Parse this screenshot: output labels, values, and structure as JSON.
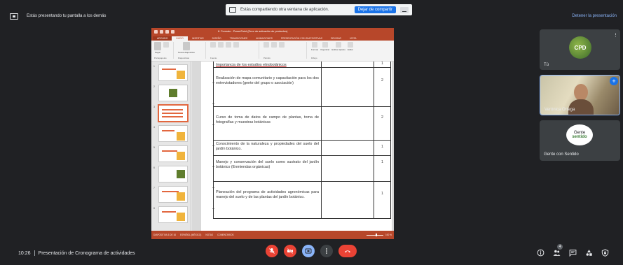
{
  "share_banner": {
    "text": "Estás compartiendo otra ventana de aplicación.",
    "stop_label": "Dejar de compartir"
  },
  "top_bar": {
    "presenting_text": "Estás presentando tu pantalla a los demás",
    "stop_presenting_label": "Detener la presentación"
  },
  "ppt": {
    "window_title": "8. Formato - PowerPoint (Error de activación de productos)",
    "tabs": [
      "ARCHIVO",
      "INICIO",
      "INSERTAR",
      "DISEÑO",
      "TRANSICIONES",
      "ANIMACIONES",
      "PRESENTACIÓN CON DIAPOSITIVAS",
      "REVISAR",
      "VISTA"
    ],
    "ribbon": {
      "paste": "Pegar",
      "new_slide": "Nueva diapositiva",
      "shapes": "Formas",
      "arrange": "Organizar",
      "quick_styles": "Estilos rápidos",
      "edit": "Editar",
      "groups": [
        "Portapapeles",
        "Diapositivas",
        "Fuente",
        "Párrafo",
        "Dibujo"
      ]
    },
    "thumbnail_numbers": [
      "1",
      "2",
      "3",
      "4",
      "5",
      "6",
      "7",
      "8"
    ],
    "table_rows": [
      {
        "activity": "Importancia de los estudios etnobotánicos",
        "value": "1"
      },
      {
        "activity": "Realización de mapa comunitario y capacitación para los dos entrevistadores (gente del grupo o asociación)",
        "value": "2"
      },
      {
        "activity": "Curso de toma de datos de campo de plantas, toma de fotografías y muestras botánicas",
        "value": "2"
      },
      {
        "activity": "Conocimiento de la naturaleza y propiedades del suelo del jardín botánico.",
        "value": "1"
      },
      {
        "activity": "Manejo y conservación del suelo como sustrato del jardín botánico (Enmiendas orgánicas)",
        "value": "1"
      },
      {
        "activity": "Planeación del programa de actividades agronómicas para manejo del suelo y de las plantas del jardín botánico.",
        "value": "1"
      }
    ],
    "status": {
      "slide_info": "DIAPOSITIVA 3 DE 16",
      "language": "ESPAÑOL (MÉXICO)",
      "notes": "NOTAS",
      "comments": "COMENTARIOS",
      "zoom": "100 %",
      "zoom_level": 0.6
    }
  },
  "participants": {
    "self": {
      "avatar_text": "CPD",
      "name": "Tú"
    },
    "speaker": {
      "name": "Verónica Ortega"
    },
    "group": {
      "avatar_line1": "Gente",
      "avatar_line2": "sentido",
      "name": "Gente con Sentido"
    }
  },
  "bottom_bar": {
    "time": "10:26",
    "meeting_title": "Presentación de Cronograma de actividades",
    "participant_count": "4"
  },
  "colors": {
    "meet_bg": "#202124",
    "tile_bg": "#3c4043",
    "ppt_accent": "#b7472a",
    "danger": "#ea4335",
    "active": "#8ab4f8"
  }
}
